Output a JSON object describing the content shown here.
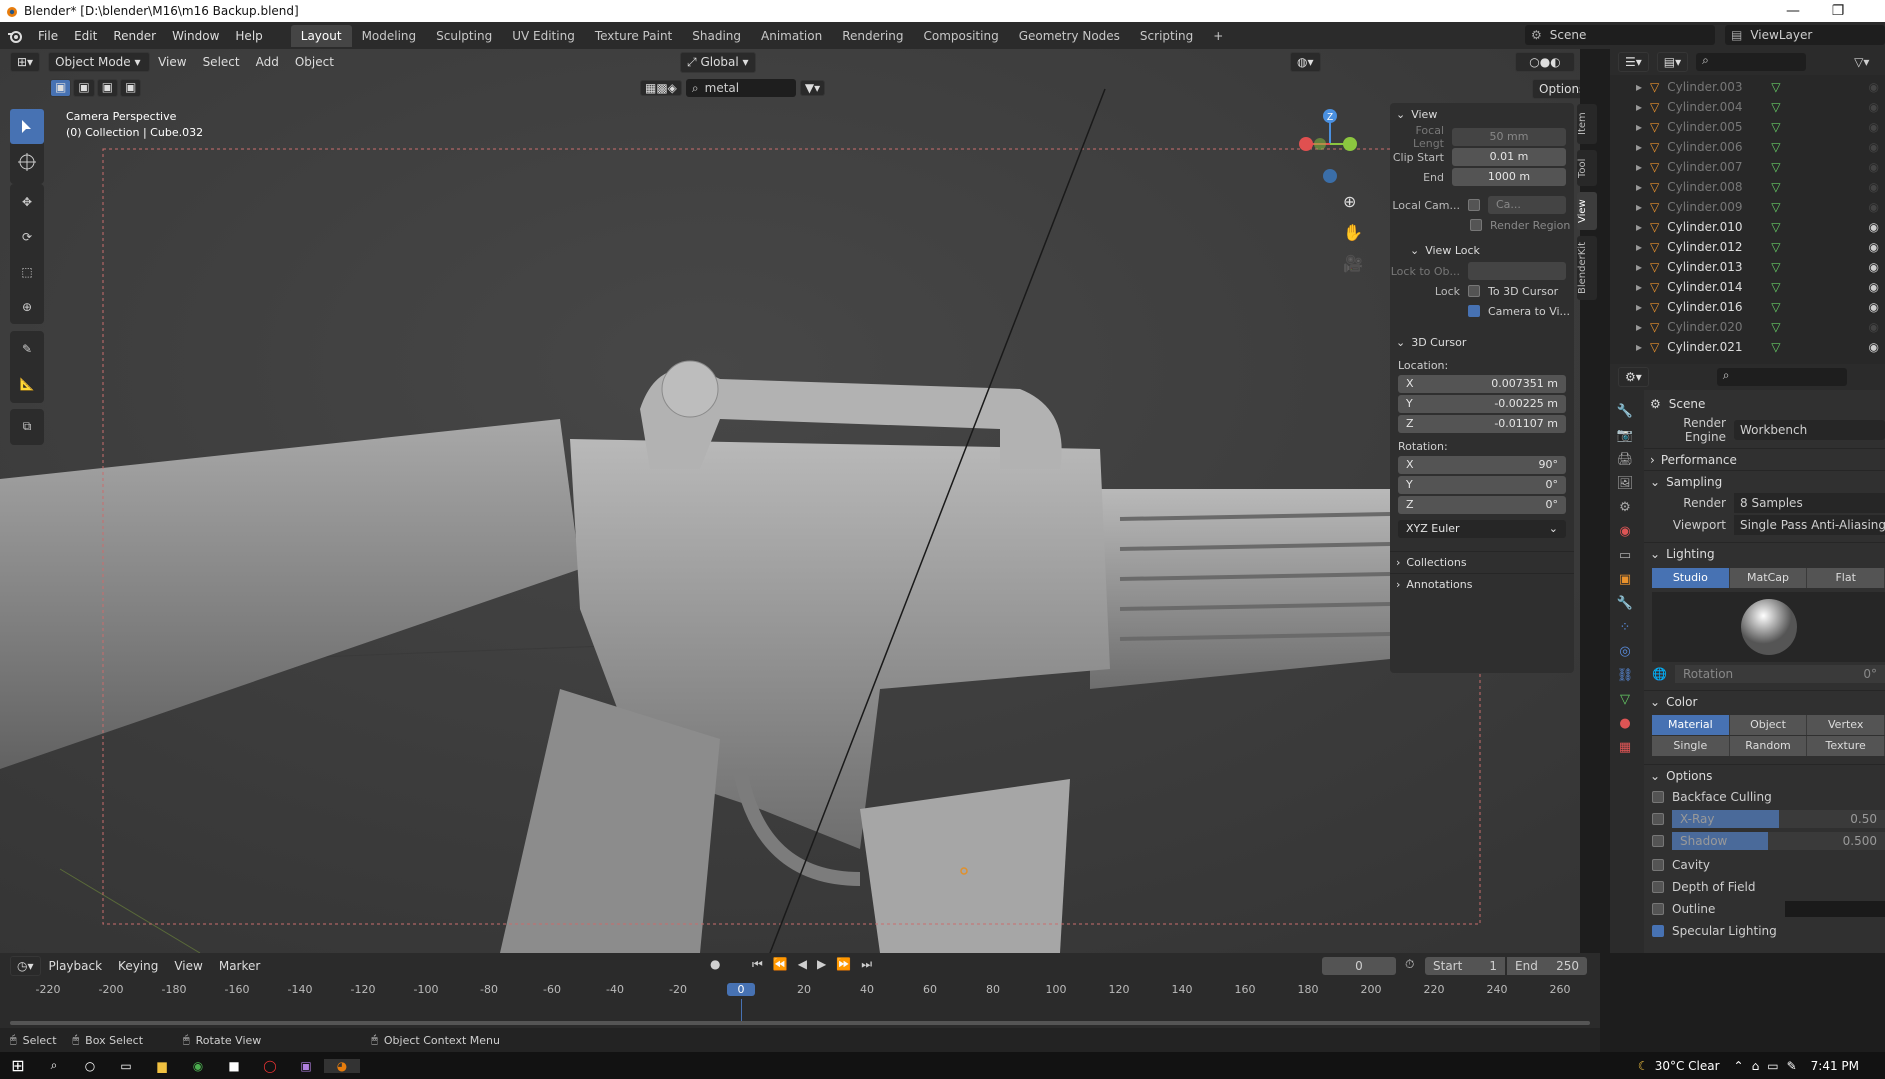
{
  "titlebar": {
    "title": "Blender* [D:\\blender\\M16\\m16 Backup.blend]",
    "minimize": "—",
    "maximize": "❐",
    "close": "✕"
  },
  "menus": [
    "File",
    "Edit",
    "Render",
    "Window",
    "Help"
  ],
  "workspaces": [
    "Layout",
    "Modeling",
    "Sculpting",
    "UV Editing",
    "Texture Paint",
    "Shading",
    "Animation",
    "Rendering",
    "Compositing",
    "Geometry Nodes",
    "Scripting"
  ],
  "add_workspace": "+",
  "scene": {
    "label": "Scene",
    "viewlayer": "ViewLayer"
  },
  "viewport": {
    "mode": "Object Mode",
    "menu": [
      "View",
      "Select",
      "Add",
      "Object"
    ],
    "orientation": "Global",
    "search_value": "metal",
    "options_label": "Options",
    "camera_title": "Camera Perspective",
    "camera_sub": "(0) Collection | Cube.032",
    "gizmo_z": "Z"
  },
  "npanel": {
    "tabs": [
      "Item",
      "Tool",
      "View",
      "BlenderKit"
    ],
    "view_header": "View",
    "focal_label": "Focal Lengt",
    "focal_value": "50 mm",
    "clip_start_label": "Clip Start",
    "clip_start_value": "0.01 m",
    "end_label": "End",
    "end_value": "1000 m",
    "local_cam_label": "Local Cam...",
    "local_cam_value": "Ca...",
    "render_region": "Render Region",
    "view_lock_header": "View Lock",
    "lock_to_label": "Lock to Ob...",
    "lock_label": "Lock",
    "to_3d_cursor": "To 3D Cursor",
    "camera_to_view": "Camera to Vi...",
    "cursor_header": "3D Cursor",
    "location_label": "Location:",
    "loc_x": "0.007351 m",
    "loc_y": "-0.00225 m",
    "loc_z": "-0.01107 m",
    "rotation_label": "Rotation:",
    "rot_x": "90°",
    "rot_y": "0°",
    "rot_z": "0°",
    "axis_x": "X",
    "axis_y": "Y",
    "axis_z": "Z",
    "euler": "XYZ Euler",
    "collections": "Collections",
    "annotations": "Annotations"
  },
  "outliner": {
    "items": [
      {
        "name": "Cylinder.003",
        "dim": true
      },
      {
        "name": "Cylinder.004",
        "dim": true
      },
      {
        "name": "Cylinder.005",
        "dim": true
      },
      {
        "name": "Cylinder.006",
        "dim": true
      },
      {
        "name": "Cylinder.007",
        "dim": true
      },
      {
        "name": "Cylinder.008",
        "dim": true
      },
      {
        "name": "Cylinder.009",
        "dim": true
      },
      {
        "name": "Cylinder.010",
        "dim": false
      },
      {
        "name": "Cylinder.012",
        "dim": false
      },
      {
        "name": "Cylinder.013",
        "dim": false
      },
      {
        "name": "Cylinder.014",
        "dim": false
      },
      {
        "name": "Cylinder.016",
        "dim": false
      },
      {
        "name": "Cylinder.020",
        "dim": true
      },
      {
        "name": "Cylinder.021",
        "dim": false
      }
    ]
  },
  "props": {
    "scene_label": "Scene",
    "render_engine_label": "Render Engine",
    "render_engine_value": "Workbench",
    "performance": "Performance",
    "sampling": "Sampling",
    "render_label": "Render",
    "render_value": "8 Samples",
    "viewport_label": "Viewport",
    "viewport_value": "Single Pass Anti-Aliasing",
    "lighting": "Lighting",
    "lighting_opts": [
      "Studio",
      "MatCap",
      "Flat"
    ],
    "rotation_label": "Rotation",
    "rotation_value": "0°",
    "color": "Color",
    "color_row1": [
      "Material",
      "Object",
      "Vertex"
    ],
    "color_row2": [
      "Single",
      "Random",
      "Texture"
    ],
    "options": "Options",
    "backface": "Backface Culling",
    "xray": "X-Ray",
    "xray_value": "0.50",
    "shadow": "Shadow",
    "shadow_value": "0.500",
    "cavity": "Cavity",
    "dof": "Depth of Field",
    "outline": "Outline",
    "specular": "Specular Lighting"
  },
  "timeline": {
    "menus": [
      "Playback",
      "Keying",
      "View",
      "Marker"
    ],
    "current_frame": "0",
    "start_label": "Start",
    "start_value": "1",
    "end_label": "End",
    "end_value": "250",
    "ticks": [
      "-220",
      "-200",
      "-180",
      "-160",
      "-140",
      "-120",
      "-100",
      "-80",
      "-60",
      "-40",
      "-20",
      "0",
      "20",
      "40",
      "60",
      "80",
      "100",
      "120",
      "140",
      "160",
      "180",
      "200",
      "220",
      "240",
      "260"
    ],
    "playhead": "0"
  },
  "statusbar": {
    "select": "Select",
    "box_select": "Box Select",
    "rotate_view": "Rotate View",
    "context_menu": "Object Context Menu"
  },
  "taskbar": {
    "weather": "30°C  Clear",
    "time": "7:41 PM"
  },
  "colors": {
    "accent": "#4772b3",
    "viewport_bg": "#3d3d3d",
    "panel_bg": "#2b2b2b"
  }
}
